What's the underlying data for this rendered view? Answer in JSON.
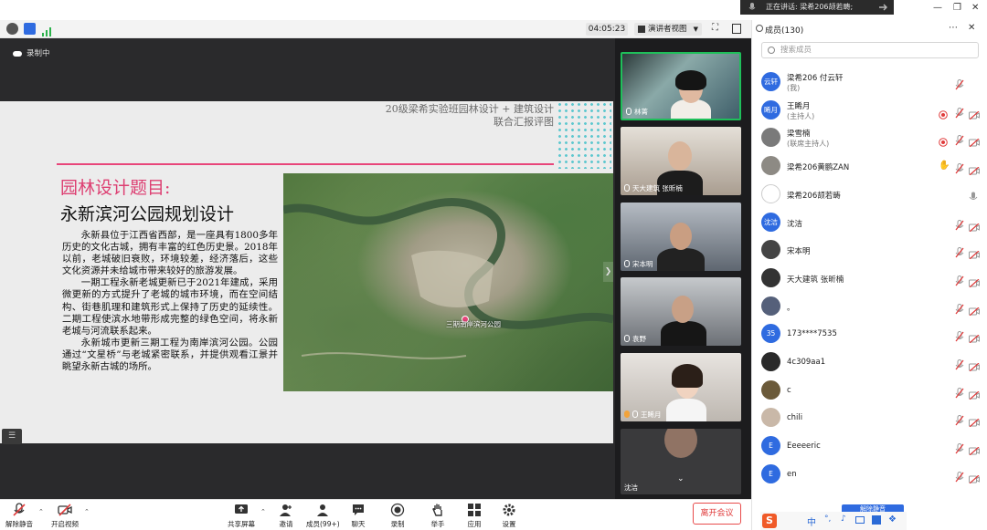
{
  "topbar": {
    "speaking_text": "正在讲话: 梁希206颉若畴;",
    "window_controls": [
      "minimize-icon",
      "restore-icon",
      "close-icon"
    ]
  },
  "meeting": {
    "timer": "04:05:23",
    "view_mode": "演讲者视图",
    "recording_label": "录制中"
  },
  "slide": {
    "header_line1": "20级梁希实验班园林设计 + 建筑设计",
    "header_line2": "联合汇报评图",
    "title_red": "园林设计题目:",
    "title_black": "永新滨河公园规划设计",
    "paragraphs": [
      "永新县位于江西省西部，是一座具有1800多年历史的文化古城，拥有丰富的红色历史景。2018年以前，老城破旧衰败，环境较差，经济落后，这些文化资源并未给城市带来较好的旅游发展。",
      "一期工程永新老城更新已于2021年建成，采用微更新的方式提升了老城的城市环境，而在空间结构、街巷肌理和建筑形式上保持了历史的延续性。二期工程使滨水地带形成完整的绿色空间，将永新老城与河流联系起来。",
      "永新城市更新三期工程为南岸滨河公园。公园通过“文星桥”与老城紧密联系，并提供观看江景并眺望永新古城的场所。"
    ],
    "map_label": "三期南岸滨河公园"
  },
  "video_tiles": [
    {
      "name": "林菁",
      "bg": "#5a8aa0"
    },
    {
      "name": "天大建筑 张昕楠",
      "bg": "#b9b0a6"
    },
    {
      "name": "宋本明",
      "bg": "#6f7a86"
    },
    {
      "name": "袁野",
      "bg": "#8a8f96"
    },
    {
      "name": "王睎月",
      "bg": "#c9c4bf"
    },
    {
      "name": "沈洁",
      "bg": "#3a3a3c"
    }
  ],
  "members_panel": {
    "title": "成员(130)",
    "search_placeholder": "搜索成员",
    "members": [
      {
        "avatar_text": "云轩",
        "name": "梁希206 付云轩",
        "role": "(我)",
        "avatar_color": "#2f6be0",
        "icons": [
          "mic-off"
        ]
      },
      {
        "avatar_text": "睎月",
        "name": "王睎月",
        "role": "(主持人)",
        "avatar_color": "#2f6be0",
        "icons": [
          "recording",
          "mic-off",
          "cam-off"
        ]
      },
      {
        "avatar_text": "",
        "name": "梁雪楠",
        "role": "(联席主持人)",
        "avatar_color": "#7a7a7a",
        "icons": [
          "recording",
          "mic-off",
          "cam-off"
        ]
      },
      {
        "avatar_text": "",
        "name": "梁希206黄鹏ZAN",
        "role": "",
        "avatar_color": "#8d8a84",
        "icons": [
          "hand",
          "mic-off",
          "cam-off"
        ]
      },
      {
        "avatar_text": "",
        "name": "梁希206颉若畴",
        "role": "",
        "avatar_color": "#ffffff",
        "icons": [
          "mic-on"
        ]
      },
      {
        "avatar_text": "沈洁",
        "name": "沈洁",
        "role": "",
        "avatar_color": "#2f6be0",
        "icons": [
          "mic-off",
          "cam-off"
        ]
      },
      {
        "avatar_text": "",
        "name": "宋本明",
        "role": "",
        "avatar_color": "#444",
        "icons": [
          "mic-off",
          "cam-off"
        ]
      },
      {
        "avatar_text": "",
        "name": "天大建筑 张昕楠",
        "role": "",
        "avatar_color": "#333",
        "icons": [
          "mic-off",
          "cam-off"
        ]
      },
      {
        "avatar_text": "",
        "name": "。",
        "role": "",
        "avatar_color": "#55607a",
        "icons": [
          "mic-off",
          "cam-off"
        ]
      },
      {
        "avatar_text": "35",
        "name": "173****7535",
        "role": "",
        "avatar_color": "#2f6be0",
        "icons": [
          "mic-off",
          "cam-off"
        ]
      },
      {
        "avatar_text": "",
        "name": "4c309aa1",
        "role": "",
        "avatar_color": "#2a2a2a",
        "icons": [
          "mic-off",
          "cam-off"
        ]
      },
      {
        "avatar_text": "",
        "name": "c",
        "role": "",
        "avatar_color": "#6b5a3a",
        "icons": [
          "mic-off",
          "cam-off"
        ]
      },
      {
        "avatar_text": "",
        "name": "chili",
        "role": "",
        "avatar_color": "#c9b8a8",
        "icons": [
          "mic-off",
          "cam-off"
        ]
      },
      {
        "avatar_text": "E",
        "name": "Eeeeeric",
        "role": "",
        "avatar_color": "#2f6be0",
        "icons": [
          "mic-off",
          "cam-off"
        ]
      },
      {
        "avatar_text": "E",
        "name": "en",
        "role": "",
        "avatar_color": "#2f6be0",
        "icons": [
          "mic-off",
          "cam-off"
        ]
      }
    ],
    "unmute_all": "解除静音"
  },
  "toolbar": {
    "unmute": "解除静音",
    "start_video": "开启视频",
    "share_screen": "共享屏幕",
    "invite": "邀请",
    "members": "成员(99+)",
    "chat": "聊天",
    "record": "录制",
    "raise_hand": "举手",
    "apps": "应用",
    "settings": "设置",
    "leave": "离开会议"
  },
  "ime": {
    "lang": "中"
  },
  "colors": {
    "accent_blue": "#2f6be0",
    "slide_pink": "#e8457a",
    "leave_red": "#e03b3b",
    "stage_dark": "#2a2a2c"
  }
}
